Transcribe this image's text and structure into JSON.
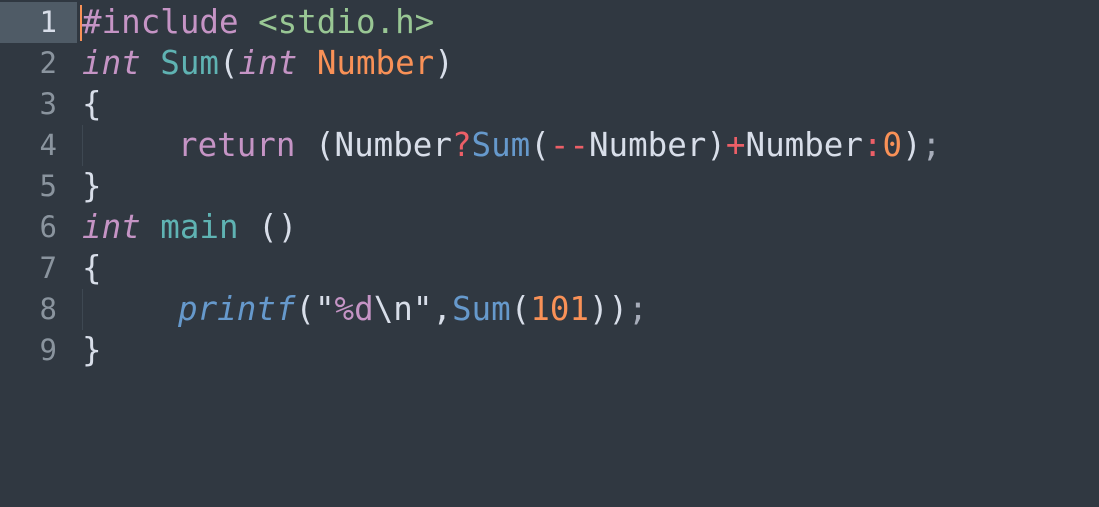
{
  "editor": {
    "active_line": 1,
    "colors": {
      "background": "#303841",
      "keyword": "#c594c5",
      "function": "#5fb3b3",
      "parameter": "#f99157",
      "string": "#99c794",
      "operator": "#ec5f67",
      "call": "#6699cc"
    },
    "lines": [
      {
        "number": "1",
        "indent": false,
        "tokens": [
          [
            "#include ",
            "kw"
          ],
          [
            "<stdio.h>",
            "str"
          ]
        ]
      },
      {
        "number": "2",
        "indent": false,
        "tokens": [
          [
            "int",
            "type"
          ],
          [
            " ",
            "p"
          ],
          [
            "Sum",
            "fn"
          ],
          [
            "(",
            "p"
          ],
          [
            "int",
            "type"
          ],
          [
            " ",
            "p"
          ],
          [
            "Number",
            "param"
          ],
          [
            ")",
            "p"
          ]
        ]
      },
      {
        "number": "3",
        "indent": false,
        "tokens": [
          [
            "{",
            "p"
          ]
        ]
      },
      {
        "number": "4",
        "indent": true,
        "tokens": [
          [
            "return",
            "kw"
          ],
          [
            " (Number",
            "p"
          ],
          [
            "?",
            "op"
          ],
          [
            "Sum",
            "call"
          ],
          [
            "(",
            "p"
          ],
          [
            "--",
            "op"
          ],
          [
            "Number)",
            "p"
          ],
          [
            "+",
            "op"
          ],
          [
            "Number",
            "p"
          ],
          [
            ":",
            "op"
          ],
          [
            "0",
            "num"
          ],
          [
            ")",
            "p"
          ],
          [
            ";",
            "semi"
          ]
        ]
      },
      {
        "number": "5",
        "indent": false,
        "tokens": [
          [
            "}",
            "p"
          ]
        ]
      },
      {
        "number": "6",
        "indent": false,
        "tokens": [
          [
            "int",
            "type"
          ],
          [
            " ",
            "p"
          ],
          [
            "main",
            "fn"
          ],
          [
            " ()",
            "p"
          ]
        ]
      },
      {
        "number": "7",
        "indent": false,
        "tokens": [
          [
            "{",
            "p"
          ]
        ]
      },
      {
        "number": "8",
        "indent": true,
        "tokens": [
          [
            "printf",
            "callit"
          ],
          [
            "(\"",
            "p"
          ],
          [
            "%d",
            "esc"
          ],
          [
            "\\n",
            "p"
          ],
          [
            "\",",
            "p"
          ],
          [
            "Sum",
            "call"
          ],
          [
            "(",
            "p"
          ],
          [
            "101",
            "num"
          ],
          [
            "))",
            "p"
          ],
          [
            ";",
            "semi"
          ]
        ]
      },
      {
        "number": "9",
        "indent": false,
        "tokens": [
          [
            "}",
            "p"
          ]
        ]
      }
    ]
  }
}
